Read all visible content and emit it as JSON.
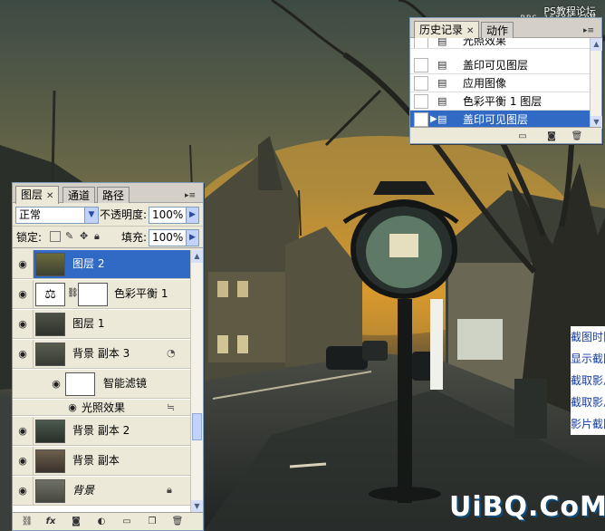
{
  "watermark": {
    "site_cn": "PS教程论坛",
    "site_url": "BBS.16XX8.COM",
    "logo": "UiBQ.CoM"
  },
  "history_panel": {
    "tabs": [
      {
        "label": "历史记录"
      },
      {
        "label": "动作"
      }
    ],
    "items": [
      {
        "label": "光照效果"
      },
      {
        "label": "盖印可见图层"
      },
      {
        "label": "应用图像"
      },
      {
        "label": "色彩平衡 1 图层"
      },
      {
        "label": "盖印可见图层",
        "selected": true
      }
    ]
  },
  "layers_panel": {
    "tabs": [
      {
        "label": "图层"
      },
      {
        "label": "通道"
      },
      {
        "label": "路径"
      }
    ],
    "blend_mode": "正常",
    "opacity_label": "不透明度:",
    "opacity_value": "100%",
    "lock_label": "锁定:",
    "fill_label": "填充:",
    "fill_value": "100%",
    "layers": [
      {
        "name": "图层 2",
        "selected": true
      },
      {
        "name": "色彩平衡 1"
      },
      {
        "name": "图层 1"
      },
      {
        "name": "背景 副本 3"
      },
      {
        "name": "智能滤镜"
      },
      {
        "name": "光照效果"
      },
      {
        "name": "背景 副本 2"
      },
      {
        "name": "背景 副本"
      },
      {
        "name": "背景"
      }
    ]
  },
  "side_menu": {
    "items": [
      "截图时隐",
      "显示截图",
      "截取影片",
      "截取影片",
      "影片截图"
    ]
  },
  "colors": {
    "selection": "#316ac5",
    "panel_bg": "#ece9d8",
    "sky_glow": "#d99a2b"
  }
}
